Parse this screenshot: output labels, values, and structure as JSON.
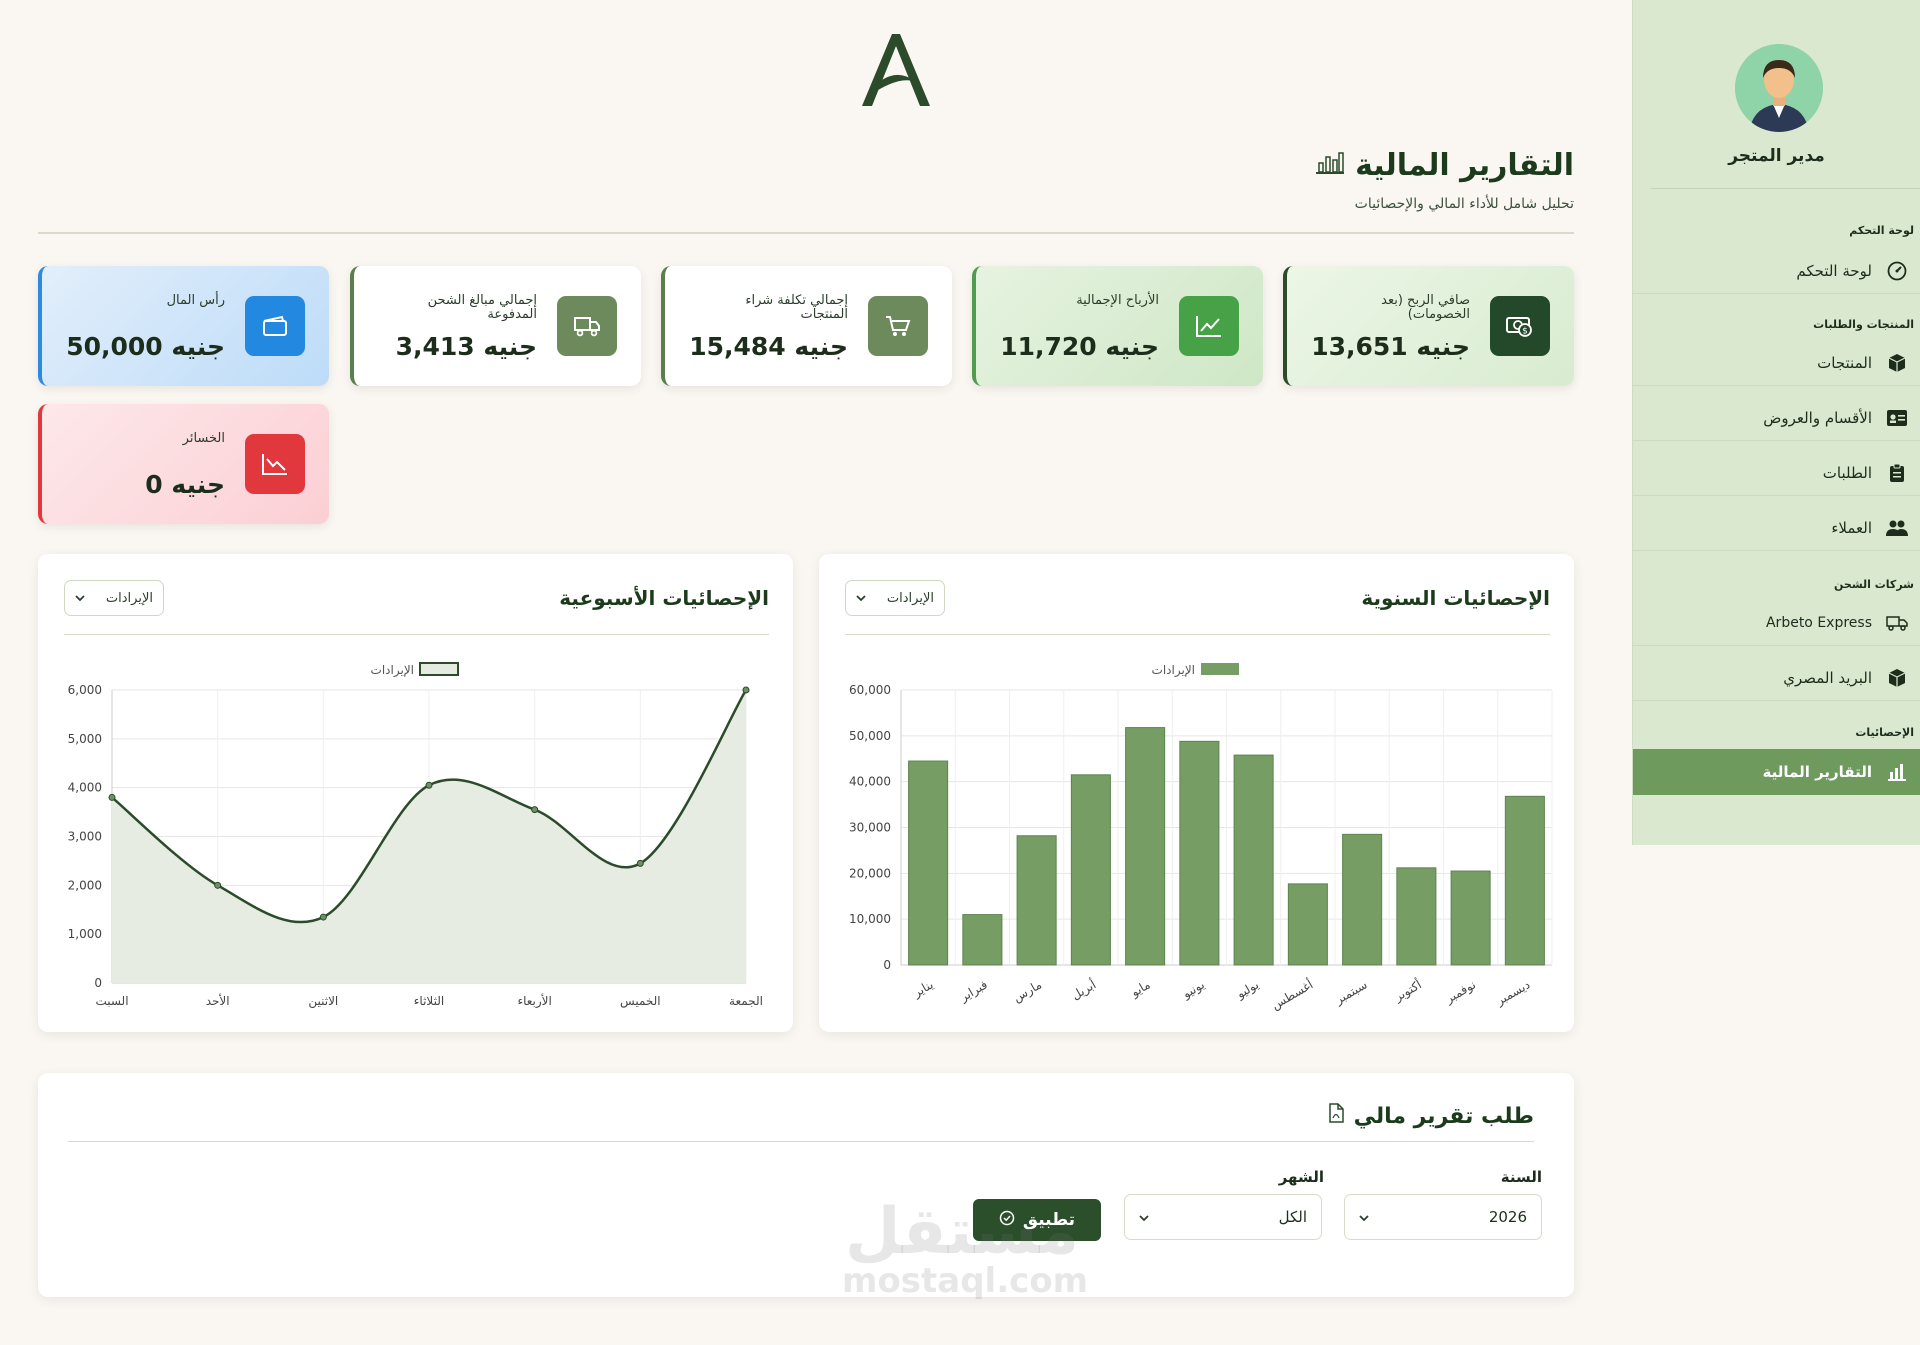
{
  "sidebar": {
    "user_name": "مدير المتجر",
    "sections": {
      "dashboard": "لوحة التحكم",
      "products_orders": "المنتجات والطلبات",
      "shipping": "شركات الشحن",
      "stats": "الإحصائيات"
    },
    "items": [
      {
        "label": "لوحة التحكم",
        "icon": "gauge-icon"
      },
      {
        "label": "المنتجات",
        "icon": "box-icon"
      },
      {
        "label": "الأقسام والعروض",
        "icon": "id-card-icon"
      },
      {
        "label": "الطلبات",
        "icon": "clipboard-icon"
      },
      {
        "label": "العملاء",
        "icon": "users-icon"
      },
      {
        "label": "Arbeto Express",
        "icon": "truck-icon"
      },
      {
        "label": "البريد المصري",
        "icon": "box-icon"
      },
      {
        "label": "التقارير المالية",
        "icon": "bar-chart-icon"
      }
    ]
  },
  "header": {
    "logo": "A",
    "title": "التقارير المالية",
    "subtitle": "تحليل شامل للأداء المالي والإحصائيات"
  },
  "cards": [
    {
      "label": "صافي الربح (بعد الخصومات)",
      "value": "13,651 جنيه",
      "icon": "money-icon",
      "color": "#23482a"
    },
    {
      "label": "الأرباح الإجمالية",
      "value": "11,720 جنيه",
      "icon": "trend-up-icon",
      "color": "#46a147"
    },
    {
      "label": "إجمالي تكلفة شراء المنتجات",
      "value": "15,484 جنيه",
      "icon": "cart-icon",
      "color": "#6c8a5c"
    },
    {
      "label": "إجمالي مبالغ الشحن المدفوعة",
      "value": "3,413 جنيه",
      "icon": "truck-icon",
      "color": "#6c8a5c"
    },
    {
      "label": "رأس المال",
      "value": "50,000 جنيه",
      "icon": "wallet-icon",
      "color": "#2288e0"
    },
    {
      "label": "الخسائر",
      "value": "0 جنيه",
      "icon": "trend-down-icon",
      "color": "#e0383c"
    }
  ],
  "yearly": {
    "title": "الإحصائيات السنوية",
    "select": "الإيرادات"
  },
  "weekly": {
    "title": "الإحصائيات الأسبوعية",
    "select": "الإيرادات"
  },
  "report": {
    "title": "طلب تقرير مالي",
    "year_label": "السنة",
    "year_value": "2026",
    "month_label": "الشهر",
    "month_value": "الكل",
    "apply_label": "تطبيق"
  },
  "watermark": {
    "line1": "مستقل",
    "line2": "mostaql.com"
  },
  "chart_data": [
    {
      "type": "bar",
      "title": "الإحصائيات السنوية",
      "categories": [
        "يناير",
        "فبراير",
        "مارس",
        "أبريل",
        "مايو",
        "يونيو",
        "يوليو",
        "أغسطس",
        "سبتمبر",
        "أكتوبر",
        "نوفمبر",
        "ديسمبر"
      ],
      "series": [
        {
          "name": "الإيرادات",
          "values": [
            44500,
            11000,
            28200,
            41500,
            51800,
            48800,
            45800,
            17700,
            28500,
            21200,
            20500,
            36800
          ]
        }
      ],
      "ylim": [
        0,
        60000
      ],
      "yticks": [
        "0",
        "10,000",
        "20,000",
        "30,000",
        "40,000",
        "50,000",
        "60,000"
      ],
      "grid": true,
      "legend": "top-center",
      "color": "#769d63"
    },
    {
      "type": "area",
      "title": "الإحصائيات الأسبوعية",
      "categories": [
        "السبت",
        "الأحد",
        "الاثنين",
        "الثلاثاء",
        "الأربعاء",
        "الخميس",
        "الجمعة"
      ],
      "series": [
        {
          "name": "الإيرادات",
          "values": [
            3800,
            2000,
            1350,
            4050,
            3550,
            2450,
            6000
          ]
        }
      ],
      "ylim": [
        0,
        6000
      ],
      "yticks": [
        "0",
        "1,000",
        "2,000",
        "3,000",
        "4,000",
        "5,000",
        "6,000"
      ],
      "grid": true,
      "legend": "top-center",
      "color": "#2b4b2b"
    }
  ]
}
